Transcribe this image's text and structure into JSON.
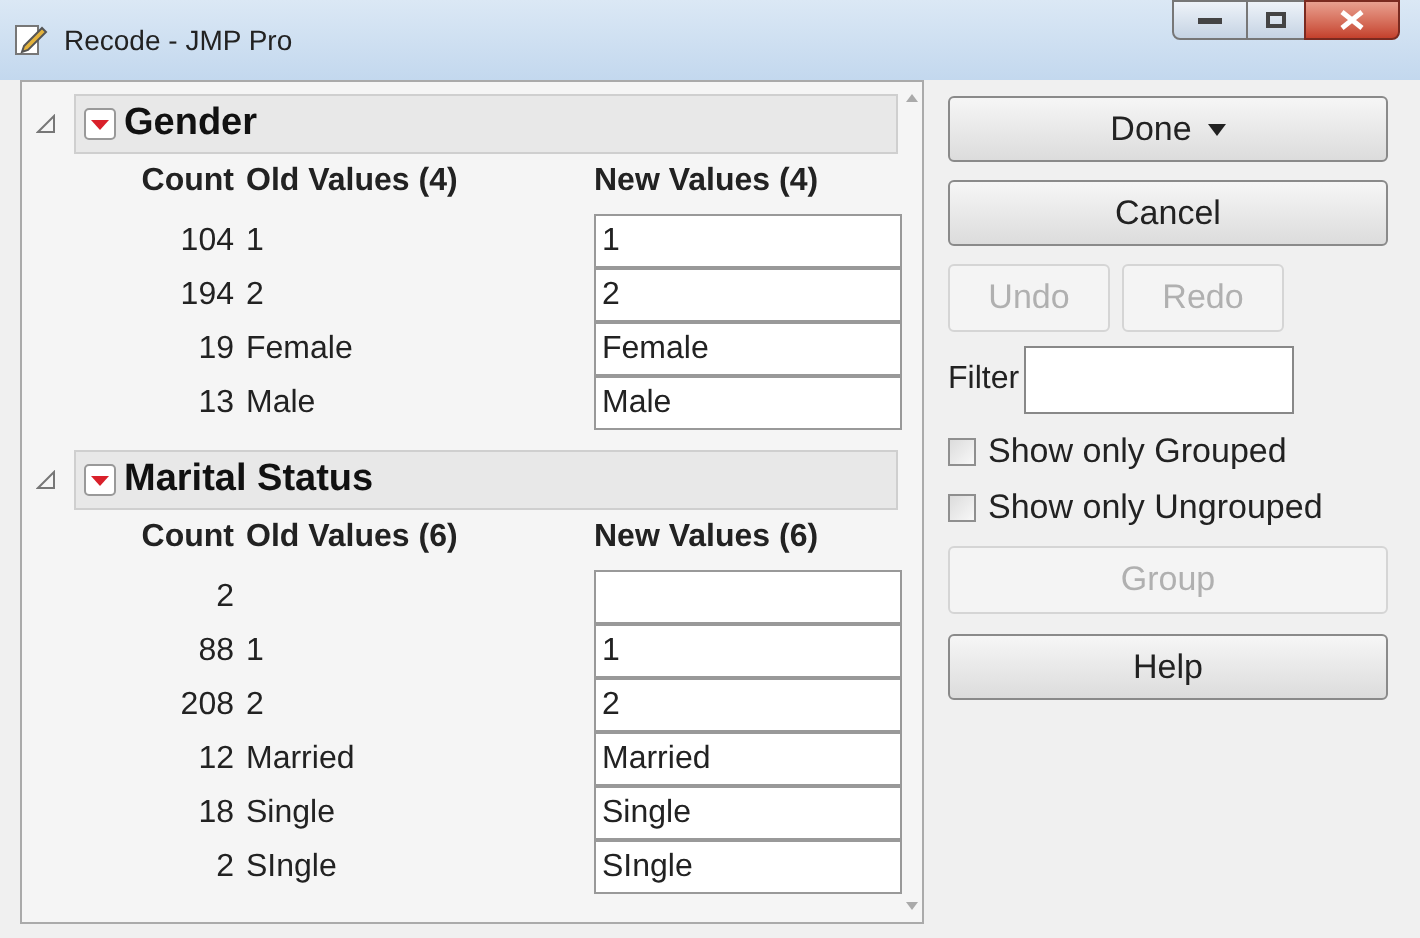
{
  "window": {
    "title": "Recode - JMP Pro"
  },
  "groups": [
    {
      "title": "Gender",
      "expanded": true,
      "columns": [
        "Count",
        "Old Values (4)",
        "New Values (4)"
      ],
      "rows": [
        {
          "count": "104",
          "old": "1",
          "new": "1"
        },
        {
          "count": "194",
          "old": "2",
          "new": "2"
        },
        {
          "count": "19",
          "old": "Female",
          "new": "Female"
        },
        {
          "count": "13",
          "old": "Male",
          "new": "Male"
        }
      ]
    },
    {
      "title": "Marital Status",
      "expanded": true,
      "columns": [
        "Count",
        "Old Values (6)",
        "New Values (6)"
      ],
      "rows": [
        {
          "count": "2"
        },
        {
          "count": "88",
          "old": "1",
          "new": "1"
        },
        {
          "count": "208",
          "old": "2",
          "new": "2"
        },
        {
          "count": "12",
          "old": "Married",
          "new": "Married"
        },
        {
          "count": "18",
          "old": "Single",
          "new": "Single"
        },
        {
          "count": "2",
          "old": "SIngle",
          "new": "SIngle"
        }
      ]
    }
  ],
  "side": {
    "done": {
      "label": "Done",
      "disabled": false
    },
    "cancel": {
      "label": "Cancel",
      "disabled": false
    },
    "undo": {
      "label": "Undo",
      "disabled": true
    },
    "redo": {
      "label": "Redo",
      "disabled": true
    },
    "filter_label": "Filter",
    "checkboxes": [
      {
        "label": "Show only Grouped",
        "checked": false
      },
      {
        "label": "Show only Ungrouped",
        "checked": false
      }
    ],
    "group": {
      "label": "Group",
      "disabled": true
    },
    "help": {
      "label": "Help",
      "disabled": false
    }
  }
}
